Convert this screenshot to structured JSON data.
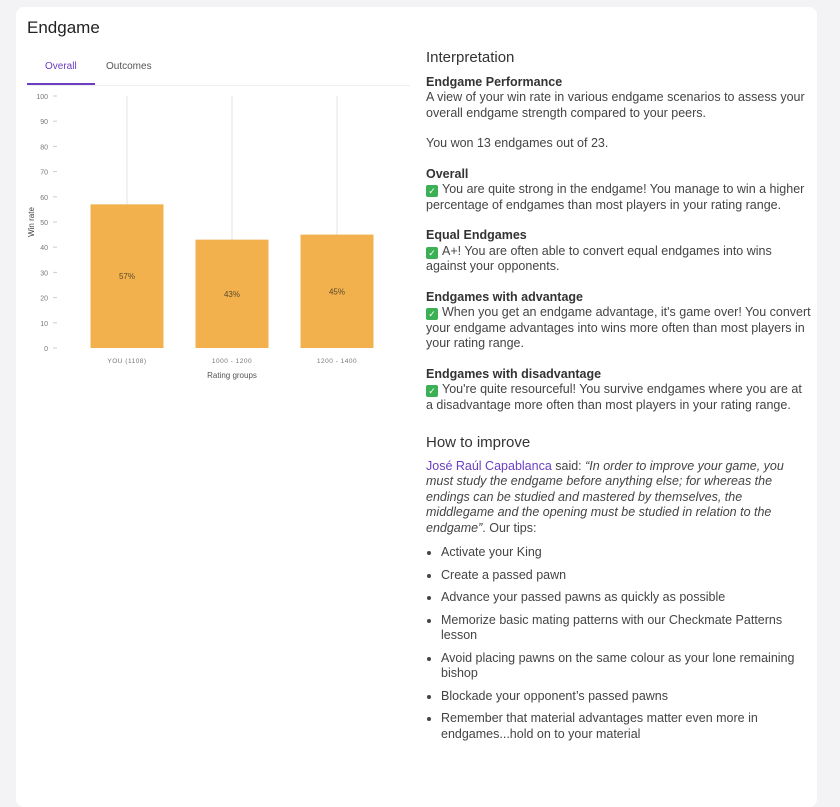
{
  "page": {
    "title": "Endgame"
  },
  "tabs": [
    {
      "label": "Overall",
      "active": true
    },
    {
      "label": "Outcomes",
      "active": false
    }
  ],
  "chart_data": {
    "type": "bar",
    "categories": [
      "YOU (1108)",
      "1000 - 1200",
      "1200 - 1400"
    ],
    "values": [
      57,
      43,
      45
    ],
    "data_labels": [
      "57%",
      "43%",
      "45%"
    ],
    "ylabel": "Win rate",
    "xlabel": "Rating groups",
    "ylim": [
      0,
      100
    ],
    "yticks": [
      0,
      10,
      20,
      30,
      40,
      50,
      60,
      70,
      80,
      90,
      100
    ],
    "bar_color": "#f2b14d",
    "grid": "vertical lines",
    "legend": "none"
  },
  "interpretation": {
    "heading": "Interpretation",
    "performance": {
      "title": "Endgame Performance",
      "text": "A view of your win rate in various endgame scenarios to assess your overall endgame strength compared to your peers.",
      "summary": "You won 13 endgames out of 23."
    },
    "sections": [
      {
        "title": "Overall",
        "icon": "check-icon",
        "text": "You are quite strong in the endgame! You manage to win a higher percentage of endgames than most players in your rating range."
      },
      {
        "title": "Equal Endgames",
        "icon": "check-icon",
        "text": "A+! You are often able to convert equal endgames into wins against your opponents."
      },
      {
        "title": "Endgames with advantage",
        "icon": "check-icon",
        "text": "When you get an endgame advantage, it's game over! You convert your endgame advantages into wins more often than most players in your rating range."
      },
      {
        "title": "Endgames with disadvantage",
        "icon": "check-icon",
        "text": "You're quite resourceful! You survive endgames where you are at a disadvantage more often than most players in your rating range."
      }
    ]
  },
  "improve": {
    "heading": "How to improve",
    "author": "José Raúl Capablanca",
    "said": " said: ",
    "quote": "“In order to improve your game, you must study the endgame before anything else; for whereas the endings can be studied and mastered by themselves, the middlegame and the opening must be studied in relation to the endgame”",
    "after": ". Our tips:",
    "tips": [
      "Activate your King",
      "Create a passed pawn",
      "Advance your passed pawns as quickly as possible",
      "Memorize basic mating patterns with our Checkmate Patterns lesson",
      "Avoid placing pawns on the same colour as your lone remaining bishop",
      "Blockade your opponent’s passed pawns",
      "Remember that material advantages matter even more in endgames...hold on to your material"
    ]
  }
}
